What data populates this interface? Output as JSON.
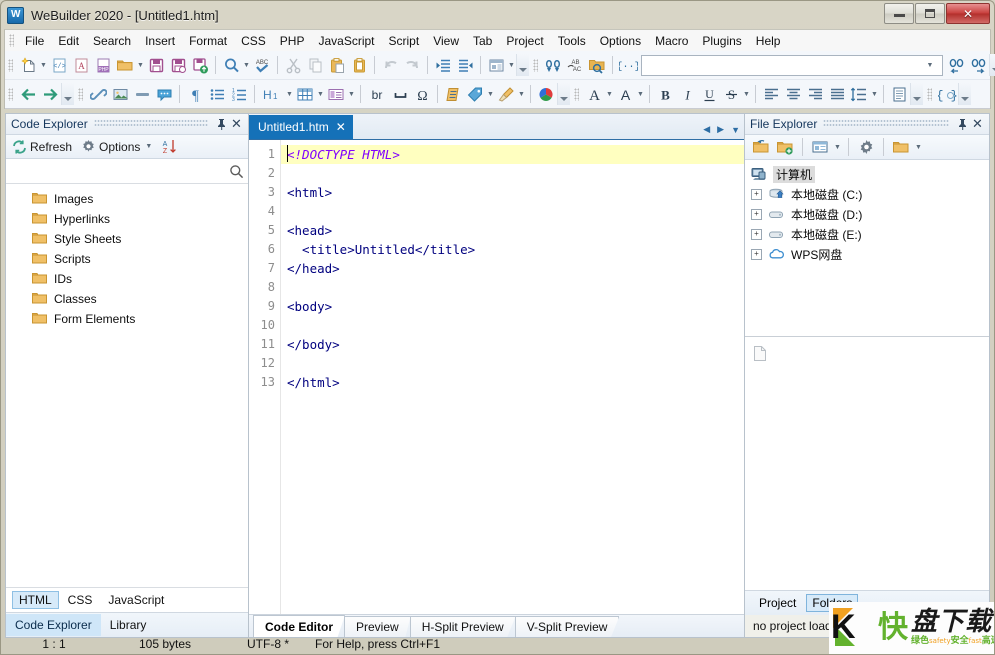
{
  "window": {
    "title": "WeBuilder 2020 - [Untitled1.htm]",
    "app_initial": "W",
    "controls": {
      "minimize": "minimize-button",
      "maximize": "maximize-button",
      "close": "✕"
    }
  },
  "menu": {
    "items": [
      {
        "label": "File"
      },
      {
        "label": "Edit"
      },
      {
        "label": "Search"
      },
      {
        "label": "Insert"
      },
      {
        "label": "Format"
      },
      {
        "label": "CSS"
      },
      {
        "label": "PHP"
      },
      {
        "label": "JavaScript"
      },
      {
        "label": "Script"
      },
      {
        "label": "View"
      },
      {
        "label": "Tab"
      },
      {
        "label": "Project"
      },
      {
        "label": "Tools"
      },
      {
        "label": "Options"
      },
      {
        "label": "Macro"
      },
      {
        "label": "Plugins"
      },
      {
        "label": "Help"
      }
    ]
  },
  "toolbar": {
    "find_value": "",
    "find_placeholder": ""
  },
  "code_explorer": {
    "title": "Code Explorer",
    "refresh_label": "Refresh",
    "options_label": "Options",
    "search_value": "",
    "search_placeholder": "",
    "items": [
      {
        "label": "Images"
      },
      {
        "label": "Hyperlinks"
      },
      {
        "label": "Style Sheets"
      },
      {
        "label": "Scripts"
      },
      {
        "label": "IDs"
      },
      {
        "label": "Classes"
      },
      {
        "label": "Form Elements"
      }
    ],
    "lang_tabs": [
      {
        "label": "HTML",
        "selected": true
      },
      {
        "label": "CSS",
        "selected": false
      },
      {
        "label": "JavaScript",
        "selected": false
      }
    ],
    "panel_tabs": [
      {
        "label": "Code Explorer",
        "selected": true
      },
      {
        "label": "Library",
        "selected": false
      }
    ]
  },
  "editor": {
    "tab": {
      "label": "Untitled1.htm",
      "close": "✕"
    },
    "lines": [
      {
        "n": "1",
        "text": "<!DOCTYPE HTML>",
        "kind": "doctype",
        "current": true
      },
      {
        "n": "2",
        "text": "",
        "kind": "plain",
        "current": false
      },
      {
        "n": "3",
        "text": "<html>",
        "kind": "tag",
        "current": false
      },
      {
        "n": "4",
        "text": "",
        "kind": "plain",
        "current": false
      },
      {
        "n": "5",
        "text": "<head>",
        "kind": "tag",
        "current": false
      },
      {
        "n": "6",
        "text": "  <title>Untitled</title>",
        "kind": "mixed",
        "current": false
      },
      {
        "n": "7",
        "text": "</head>",
        "kind": "tag",
        "current": false
      },
      {
        "n": "8",
        "text": "",
        "kind": "plain",
        "current": false
      },
      {
        "n": "9",
        "text": "<body>",
        "kind": "tag",
        "current": false
      },
      {
        "n": "10",
        "text": "",
        "kind": "plain",
        "current": false
      },
      {
        "n": "11",
        "text": "</body>",
        "kind": "tag",
        "current": false
      },
      {
        "n": "12",
        "text": "",
        "kind": "plain",
        "current": false
      },
      {
        "n": "13",
        "text": "</html>",
        "kind": "tag",
        "current": false
      }
    ],
    "view_tabs": [
      {
        "label": "Code Editor",
        "selected": true
      },
      {
        "label": "Preview",
        "selected": false
      },
      {
        "label": "H-Split Preview",
        "selected": false
      },
      {
        "label": "V-Split Preview",
        "selected": false
      }
    ]
  },
  "file_explorer": {
    "title": "File Explorer",
    "root": "计算机",
    "items": [
      {
        "label": "本地磁盘 (C:)",
        "icon": "system-drive-icon",
        "expander": "+"
      },
      {
        "label": "本地磁盘 (D:)",
        "icon": "drive-icon",
        "expander": "+"
      },
      {
        "label": "本地磁盘 (E:)",
        "icon": "drive-icon",
        "expander": "+"
      },
      {
        "label": "WPS网盘",
        "icon": "cloud-icon",
        "expander": "+"
      }
    ],
    "bottom_tabs": [
      {
        "label": "Project",
        "selected": false
      },
      {
        "label": "Folders",
        "selected": true
      }
    ],
    "status": "no project loaded"
  },
  "status_bar": {
    "position": "1 : 1",
    "size": "105 bytes",
    "encoding": "UTF-8 *",
    "hint": "For Help, press Ctrl+F1"
  },
  "watermark": {
    "letter": "K",
    "kuai": "快",
    "big": "盘下载",
    "tag_green_1": "绿色",
    "tag_orange_1": "safety",
    "tag_green_2": "安全",
    "tag_orange_2": "fast",
    "tag_green_3": "高速"
  },
  "colors": {
    "accent": "#1571b8",
    "titlebar": "#d8d5c6",
    "current_line": "#ffffc0",
    "doctype": "#8000ff",
    "tag": "#00007f",
    "close_red": "#c9413f",
    "folder": "#e8b96a",
    "watermark_green": "#63b22e",
    "watermark_orange": "#f0a020"
  }
}
